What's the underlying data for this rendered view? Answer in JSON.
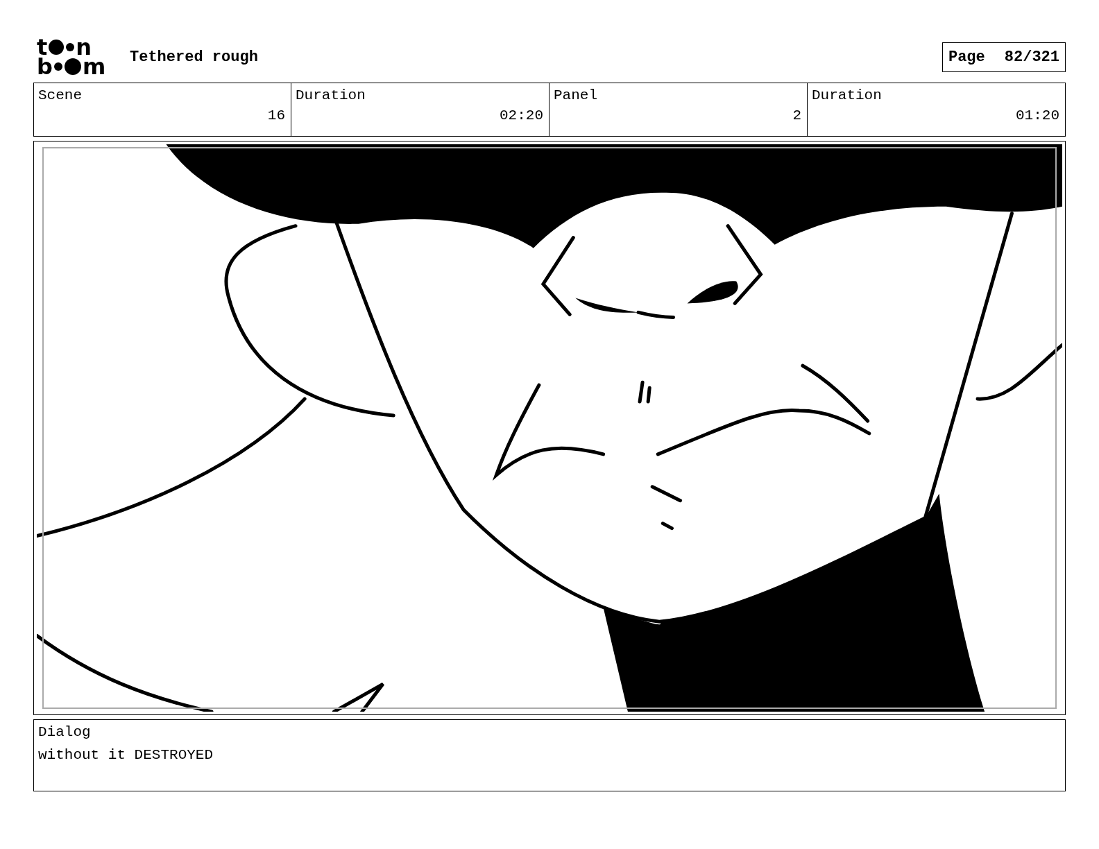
{
  "header": {
    "logo": {
      "line_1": [
        "t",
        "n"
      ],
      "line_2": [
        "b",
        "m"
      ]
    },
    "title": "Tethered rough",
    "page": {
      "label": "Page",
      "value": "82/321"
    }
  },
  "info_table": {
    "columns": [
      "Scene",
      "Duration",
      "Panel",
      "Duration"
    ],
    "row": [
      "16",
      "02:20",
      "2",
      "01:20"
    ]
  },
  "dialog": {
    "label": "Dialog",
    "text": "without it DESTROYED"
  }
}
